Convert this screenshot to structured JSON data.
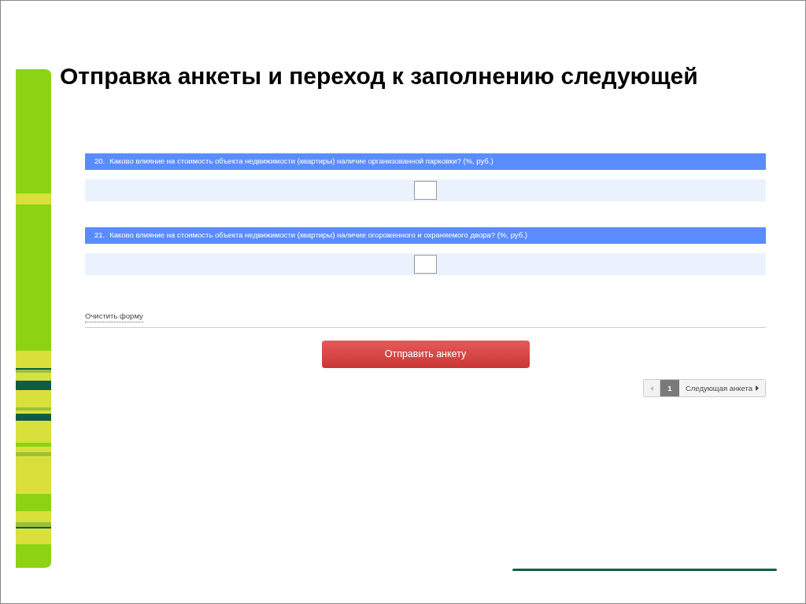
{
  "slide": {
    "title": "Отправка анкеты и переход к заполнению следующей"
  },
  "questions": [
    {
      "number": "20.",
      "text": "Каково влияние на стоимость объекта недвижимости (квартиры) наличие организованной парковки? (%, руб.)"
    },
    {
      "number": "21.",
      "text": "Каково влияние на стоимость объекта недвижимости (квартиры) наличие огороженного и охраняемого двора? (%, руб.)"
    }
  ],
  "clear_link": "Очистить форму",
  "submit_button": "Отправить анкету",
  "pagination": {
    "pages": [
      {
        "label": "1",
        "selected": true
      }
    ],
    "next": "Следующая анкета"
  }
}
